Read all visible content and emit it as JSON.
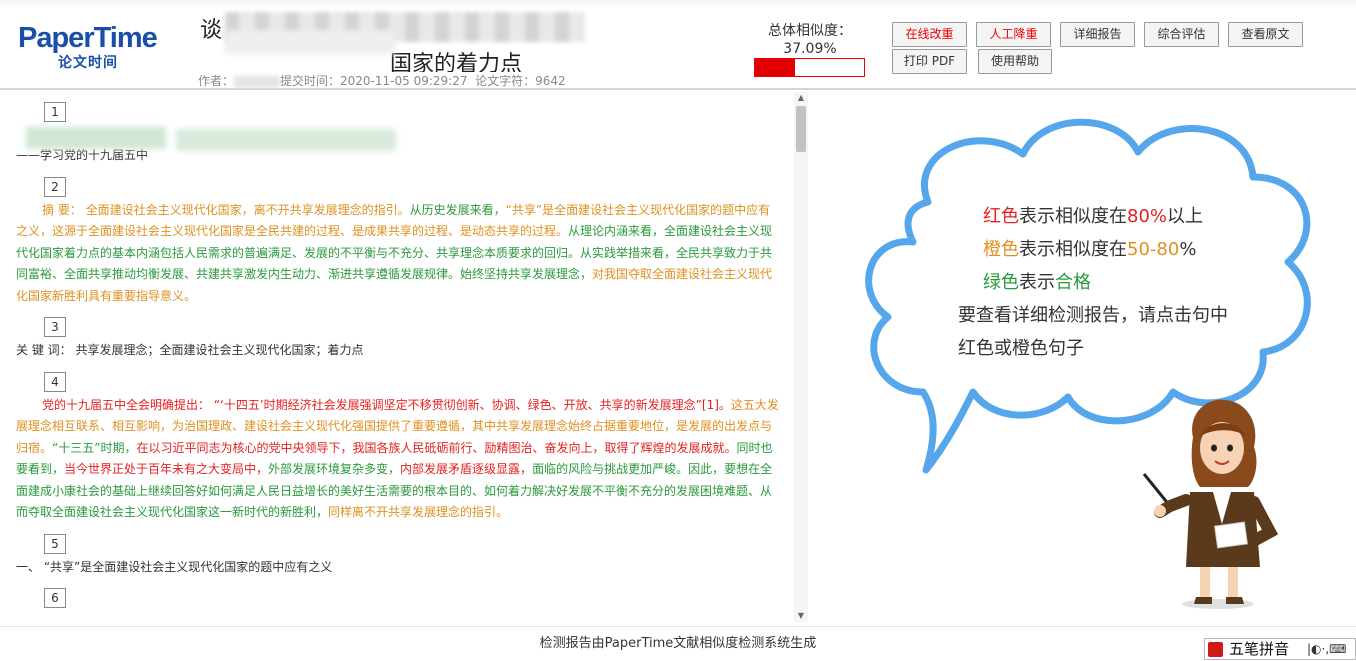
{
  "header": {
    "logo_main": "PaperTime",
    "logo_sub": "论文时间",
    "title_line1": "谈",
    "title_line2": "国家的着力点",
    "author_label": "作者：",
    "submit_label": "提交时间：",
    "submit_time": "2020-11-05 09:29:27",
    "chars_label": "论文字符：",
    "chars": "9642"
  },
  "similarity": {
    "label": "总体相似度：",
    "value": "37.09%",
    "fraction": 0.3709,
    "bar_color": "#e00000"
  },
  "buttons": {
    "online_edit": "在线改重",
    "manual_reduce": "人工降重",
    "detail_report": "详细报告",
    "overall_eval": "综合评估",
    "view_original": "查看原文",
    "print_pdf": "打印 PDF",
    "help": "使用帮助"
  },
  "paragraphs": {
    "p1_num": "1",
    "p1_tail": "——学习党的十九届五中",
    "p2_num": "2",
    "p2_orange1": "摘 要：  全面建设社会主义现代化国家，离不开共享发展理念的指引。",
    "p2_green1": "从历史发展来看，",
    "p2_orange2": "“共享”是全面建设社会主义现代化国家的题中应有之义，这源于全面建设社会主义现代化国家是全民共建的过程、是成果共享的过程、是动态共享的过程。",
    "p2_green2": "从理论内涵来看，全面建设社会主义现代化国家着力点的基本内涵包括人民需求的普遍满足、发展的不平衡与不充分、共享理念本质要求的回归。从实践举措来看，全民共享致力于共同富裕、全面共享推动均衡发展、共建共享激发内生动力、渐进共享遵循发展规律。始终坚持共享发展理念，",
    "p2_orange3": "对我国夺取全面建设社会主义现代化国家新胜利具有重要指导意义。",
    "p3_num": "3",
    "p3_text": "关 键 词：  共享发展理念；全面建设社会主义现代化国家；着力点",
    "p4_num": "4",
    "p4_red1": "党的十九届五中全会明确提出：  “‘十四五’时期经济社会发展强调坚定不移贯彻创新、协调、绿色、开放、共享的新发展理念”[1]。",
    "p4_orange1": "这五大发展理念相互联系、相互影响，为治国理政、建设社会主义现代化强国提供了重要遵循，其中共享发展理念始终占据重要地位，是发展的出发点与归宿。",
    "p4_green1": "“十三五”时期，",
    "p4_red2": "在以习近平同志为核心的党中央领导下，我国各族人民砥砺前行、励精图治、奋发向上，取得了辉煌的发展成就。",
    "p4_green2": "同时也要看到，",
    "p4_red3": "当今世界正处于百年未有之大变局中，",
    "p4_green3": "外部发展环境复杂多变，",
    "p4_red4": "内部发展矛盾逐级显露，",
    "p4_green4": "面临的风险与挑战更加严峻。因此，要想在全面建成小康社会的基础上继续回答好如何满足人民日益增长的美好生活需要的根本目的、如何着力解决好发展不平衡不充分的发展困境难题、从而夺取全面建设社会主义现代化国家这一新时代的新胜利，",
    "p4_orange2": "同样离不开共享发展理念的指引。",
    "p5_num": "5",
    "p5_text": "一、 “共享”是全面建设社会主义现代化国家的题中应有之义",
    "p6_num": "6"
  },
  "legend": {
    "red_word": "红色",
    "red_mid": "表示相似度在",
    "red_pct": "80%",
    "red_tail": "以上",
    "orange_word": "橙色",
    "orange_mid": "表示相似度在",
    "orange_pct": "50-80",
    "orange_tail": "%",
    "green_word": "绿色",
    "green_mid": "表示",
    "green_tail": "合格",
    "hint_line1": "要查看详细检测报告，请点击句中",
    "hint_line2": "红色或橙色句子"
  },
  "colors": {
    "red": "#e42121",
    "orange": "#e0901f",
    "green": "#2a9a3c",
    "cloud_border": "#56a6ec"
  },
  "footer": {
    "text": "检测报告由PaperTime文献相似度检测系统生成"
  },
  "ime": {
    "label": "五笔拼音"
  }
}
